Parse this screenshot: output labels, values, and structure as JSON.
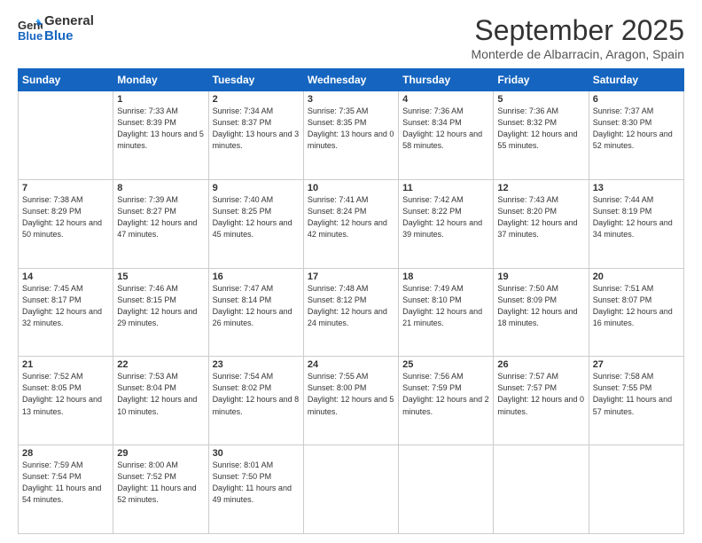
{
  "header": {
    "logo_general": "General",
    "logo_blue": "Blue",
    "title": "September 2025",
    "location": "Monterde de Albarracin, Aragon, Spain"
  },
  "weekdays": [
    "Sunday",
    "Monday",
    "Tuesday",
    "Wednesday",
    "Thursday",
    "Friday",
    "Saturday"
  ],
  "weeks": [
    [
      {
        "day": "",
        "sunrise": "",
        "sunset": "",
        "daylight": ""
      },
      {
        "day": "1",
        "sunrise": "Sunrise: 7:33 AM",
        "sunset": "Sunset: 8:39 PM",
        "daylight": "Daylight: 13 hours and 5 minutes."
      },
      {
        "day": "2",
        "sunrise": "Sunrise: 7:34 AM",
        "sunset": "Sunset: 8:37 PM",
        "daylight": "Daylight: 13 hours and 3 minutes."
      },
      {
        "day": "3",
        "sunrise": "Sunrise: 7:35 AM",
        "sunset": "Sunset: 8:35 PM",
        "daylight": "Daylight: 13 hours and 0 minutes."
      },
      {
        "day": "4",
        "sunrise": "Sunrise: 7:36 AM",
        "sunset": "Sunset: 8:34 PM",
        "daylight": "Daylight: 12 hours and 58 minutes."
      },
      {
        "day": "5",
        "sunrise": "Sunrise: 7:36 AM",
        "sunset": "Sunset: 8:32 PM",
        "daylight": "Daylight: 12 hours and 55 minutes."
      },
      {
        "day": "6",
        "sunrise": "Sunrise: 7:37 AM",
        "sunset": "Sunset: 8:30 PM",
        "daylight": "Daylight: 12 hours and 52 minutes."
      }
    ],
    [
      {
        "day": "7",
        "sunrise": "Sunrise: 7:38 AM",
        "sunset": "Sunset: 8:29 PM",
        "daylight": "Daylight: 12 hours and 50 minutes."
      },
      {
        "day": "8",
        "sunrise": "Sunrise: 7:39 AM",
        "sunset": "Sunset: 8:27 PM",
        "daylight": "Daylight: 12 hours and 47 minutes."
      },
      {
        "day": "9",
        "sunrise": "Sunrise: 7:40 AM",
        "sunset": "Sunset: 8:25 PM",
        "daylight": "Daylight: 12 hours and 45 minutes."
      },
      {
        "day": "10",
        "sunrise": "Sunrise: 7:41 AM",
        "sunset": "Sunset: 8:24 PM",
        "daylight": "Daylight: 12 hours and 42 minutes."
      },
      {
        "day": "11",
        "sunrise": "Sunrise: 7:42 AM",
        "sunset": "Sunset: 8:22 PM",
        "daylight": "Daylight: 12 hours and 39 minutes."
      },
      {
        "day": "12",
        "sunrise": "Sunrise: 7:43 AM",
        "sunset": "Sunset: 8:20 PM",
        "daylight": "Daylight: 12 hours and 37 minutes."
      },
      {
        "day": "13",
        "sunrise": "Sunrise: 7:44 AM",
        "sunset": "Sunset: 8:19 PM",
        "daylight": "Daylight: 12 hours and 34 minutes."
      }
    ],
    [
      {
        "day": "14",
        "sunrise": "Sunrise: 7:45 AM",
        "sunset": "Sunset: 8:17 PM",
        "daylight": "Daylight: 12 hours and 32 minutes."
      },
      {
        "day": "15",
        "sunrise": "Sunrise: 7:46 AM",
        "sunset": "Sunset: 8:15 PM",
        "daylight": "Daylight: 12 hours and 29 minutes."
      },
      {
        "day": "16",
        "sunrise": "Sunrise: 7:47 AM",
        "sunset": "Sunset: 8:14 PM",
        "daylight": "Daylight: 12 hours and 26 minutes."
      },
      {
        "day": "17",
        "sunrise": "Sunrise: 7:48 AM",
        "sunset": "Sunset: 8:12 PM",
        "daylight": "Daylight: 12 hours and 24 minutes."
      },
      {
        "day": "18",
        "sunrise": "Sunrise: 7:49 AM",
        "sunset": "Sunset: 8:10 PM",
        "daylight": "Daylight: 12 hours and 21 minutes."
      },
      {
        "day": "19",
        "sunrise": "Sunrise: 7:50 AM",
        "sunset": "Sunset: 8:09 PM",
        "daylight": "Daylight: 12 hours and 18 minutes."
      },
      {
        "day": "20",
        "sunrise": "Sunrise: 7:51 AM",
        "sunset": "Sunset: 8:07 PM",
        "daylight": "Daylight: 12 hours and 16 minutes."
      }
    ],
    [
      {
        "day": "21",
        "sunrise": "Sunrise: 7:52 AM",
        "sunset": "Sunset: 8:05 PM",
        "daylight": "Daylight: 12 hours and 13 minutes."
      },
      {
        "day": "22",
        "sunrise": "Sunrise: 7:53 AM",
        "sunset": "Sunset: 8:04 PM",
        "daylight": "Daylight: 12 hours and 10 minutes."
      },
      {
        "day": "23",
        "sunrise": "Sunrise: 7:54 AM",
        "sunset": "Sunset: 8:02 PM",
        "daylight": "Daylight: 12 hours and 8 minutes."
      },
      {
        "day": "24",
        "sunrise": "Sunrise: 7:55 AM",
        "sunset": "Sunset: 8:00 PM",
        "daylight": "Daylight: 12 hours and 5 minutes."
      },
      {
        "day": "25",
        "sunrise": "Sunrise: 7:56 AM",
        "sunset": "Sunset: 7:59 PM",
        "daylight": "Daylight: 12 hours and 2 minutes."
      },
      {
        "day": "26",
        "sunrise": "Sunrise: 7:57 AM",
        "sunset": "Sunset: 7:57 PM",
        "daylight": "Daylight: 12 hours and 0 minutes."
      },
      {
        "day": "27",
        "sunrise": "Sunrise: 7:58 AM",
        "sunset": "Sunset: 7:55 PM",
        "daylight": "Daylight: 11 hours and 57 minutes."
      }
    ],
    [
      {
        "day": "28",
        "sunrise": "Sunrise: 7:59 AM",
        "sunset": "Sunset: 7:54 PM",
        "daylight": "Daylight: 11 hours and 54 minutes."
      },
      {
        "day": "29",
        "sunrise": "Sunrise: 8:00 AM",
        "sunset": "Sunset: 7:52 PM",
        "daylight": "Daylight: 11 hours and 52 minutes."
      },
      {
        "day": "30",
        "sunrise": "Sunrise: 8:01 AM",
        "sunset": "Sunset: 7:50 PM",
        "daylight": "Daylight: 11 hours and 49 minutes."
      },
      {
        "day": "",
        "sunrise": "",
        "sunset": "",
        "daylight": ""
      },
      {
        "day": "",
        "sunrise": "",
        "sunset": "",
        "daylight": ""
      },
      {
        "day": "",
        "sunrise": "",
        "sunset": "",
        "daylight": ""
      },
      {
        "day": "",
        "sunrise": "",
        "sunset": "",
        "daylight": ""
      }
    ]
  ]
}
